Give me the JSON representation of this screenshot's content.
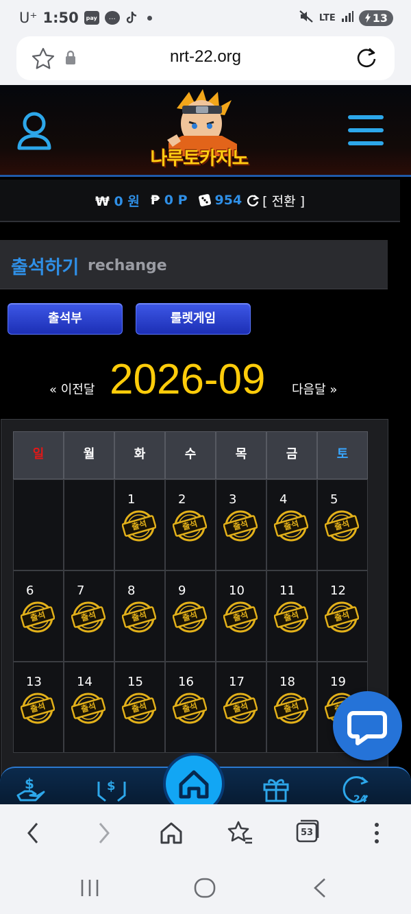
{
  "status_bar": {
    "carrier": "U⁺",
    "time": "1:50",
    "pay_badge": "pay",
    "network": "LTE",
    "battery": "13"
  },
  "browser": {
    "url": "nrt-22.org",
    "tab_count": "53"
  },
  "site": {
    "logo_text": "나루토카지노",
    "balance": {
      "won_symbol": "₩",
      "won_value": "0 원",
      "point_symbol": "₱",
      "point_value": "0 P",
      "chip_value": "954",
      "swap_label": "[ 전환 ]"
    },
    "page_title": "출석하기",
    "page_subtitle": "rechange",
    "buttons": {
      "attendance": "출석부",
      "roulette": "룰렛게임"
    },
    "month_nav": {
      "prev": "« 이전달",
      "current": "2026-09",
      "next": "다음달 »"
    },
    "weekdays": [
      "일",
      "월",
      "화",
      "수",
      "목",
      "금",
      "토"
    ],
    "calendar_rows": [
      [
        "",
        "",
        "1",
        "2",
        "3",
        "4",
        "5"
      ],
      [
        "6",
        "7",
        "8",
        "9",
        "10",
        "11",
        "12"
      ],
      [
        "13",
        "14",
        "15",
        "16",
        "17",
        "18",
        "19"
      ]
    ],
    "stamp_label": "출석"
  },
  "colors": {
    "accent_blue": "#2f8fe6",
    "month_yellow": "#ffcc0a",
    "stamp_gold": "#e3b11a",
    "sunday_red": "#e01818",
    "saturday_blue": "#39a7ff"
  }
}
